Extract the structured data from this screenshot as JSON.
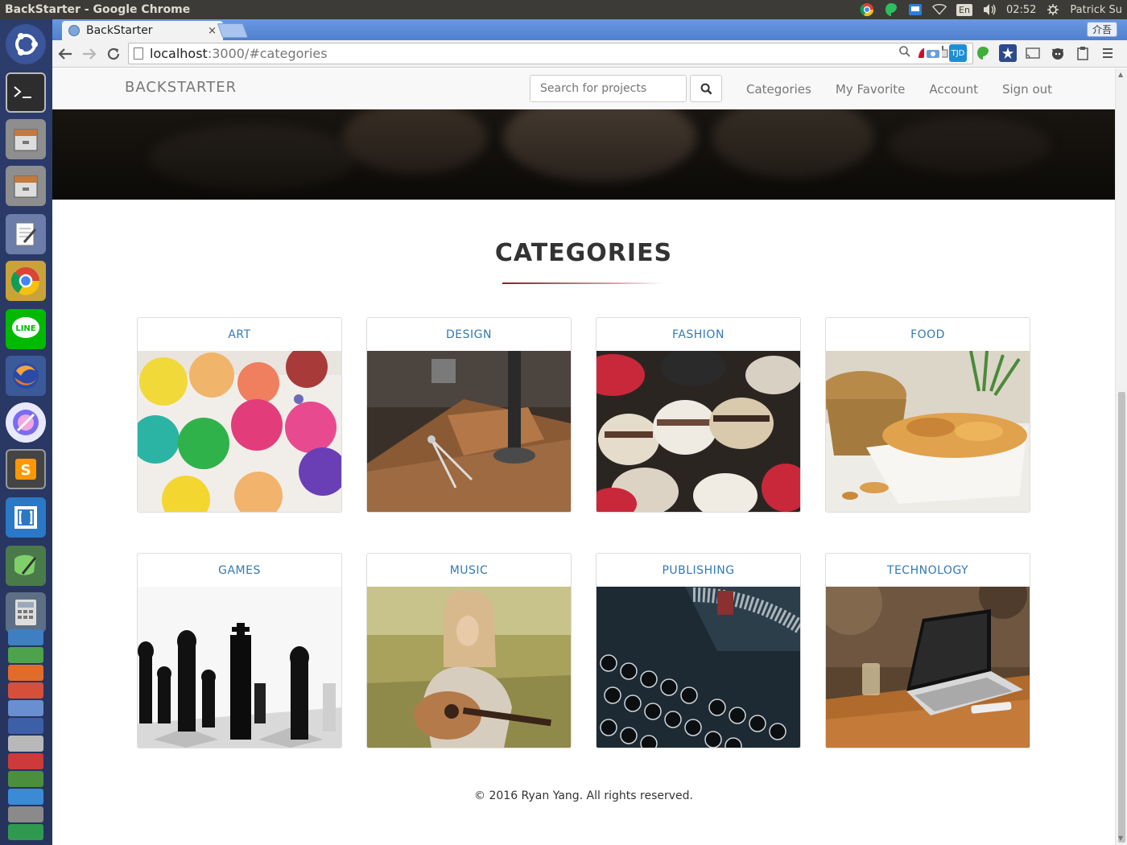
{
  "os": {
    "window_title": "BackStarter - Google Chrome",
    "lang": "En",
    "volume_icon": "volume-icon",
    "time": "02:52",
    "user": "Patrick Su"
  },
  "browser": {
    "tab_title": "BackStarter",
    "tab_close": "×",
    "profile_label": "介吾",
    "url_host": "localhost",
    "url_rest": ":3000/#categories"
  },
  "site": {
    "brand": "BACKSTARTER",
    "search_placeholder": "Search for projects",
    "nav": {
      "categories": "Categories",
      "favorite": "My Favorite",
      "account": "Account",
      "signout": "Sign out"
    },
    "heading": "CATEGORIES",
    "accent_color": "#8a1c2a",
    "link_color": "#337ab7",
    "categories": [
      {
        "label": "ART",
        "image": "watercolor-palette"
      },
      {
        "label": "DESIGN",
        "image": "desk-with-compass"
      },
      {
        "label": "FASHION",
        "image": "hats-display"
      },
      {
        "label": "FOOD",
        "image": "bowl-of-peanuts"
      },
      {
        "label": "GAMES",
        "image": "chess-pieces"
      },
      {
        "label": "MUSIC",
        "image": "girl-with-guitar"
      },
      {
        "label": "PUBLISHING",
        "image": "typewriter-keys"
      },
      {
        "label": "TECHNOLOGY",
        "image": "laptop-on-table"
      }
    ],
    "footer": "© 2016 Ryan Yang. All rights reserved."
  }
}
